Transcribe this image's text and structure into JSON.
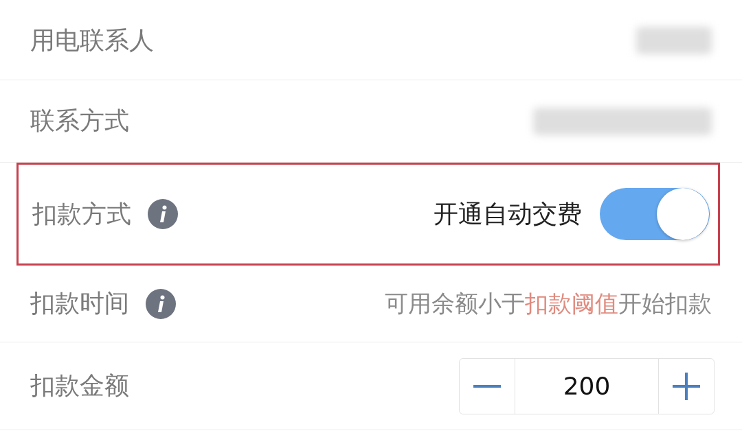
{
  "rows": [
    {
      "kind": "redacted",
      "label": "用电联系人",
      "info": false,
      "highlighted": false
    },
    {
      "kind": "redacted",
      "label": "联系方式",
      "info": false,
      "highlighted": false
    },
    {
      "kind": "toggle",
      "label": "扣款方式",
      "info": true,
      "highlighted": true,
      "value": "开通自动交费",
      "on": true
    },
    {
      "kind": "text",
      "label": "扣款时间",
      "info": true,
      "highlighted": false,
      "segments": [
        {
          "text": "可用余额小于",
          "emphasis": false
        },
        {
          "text": "扣款阈值",
          "emphasis": true
        },
        {
          "text": "开始扣款",
          "emphasis": false
        }
      ]
    },
    {
      "kind": "stepper",
      "label": "扣款金额",
      "info": false,
      "highlighted": false,
      "value": "200"
    }
  ]
}
